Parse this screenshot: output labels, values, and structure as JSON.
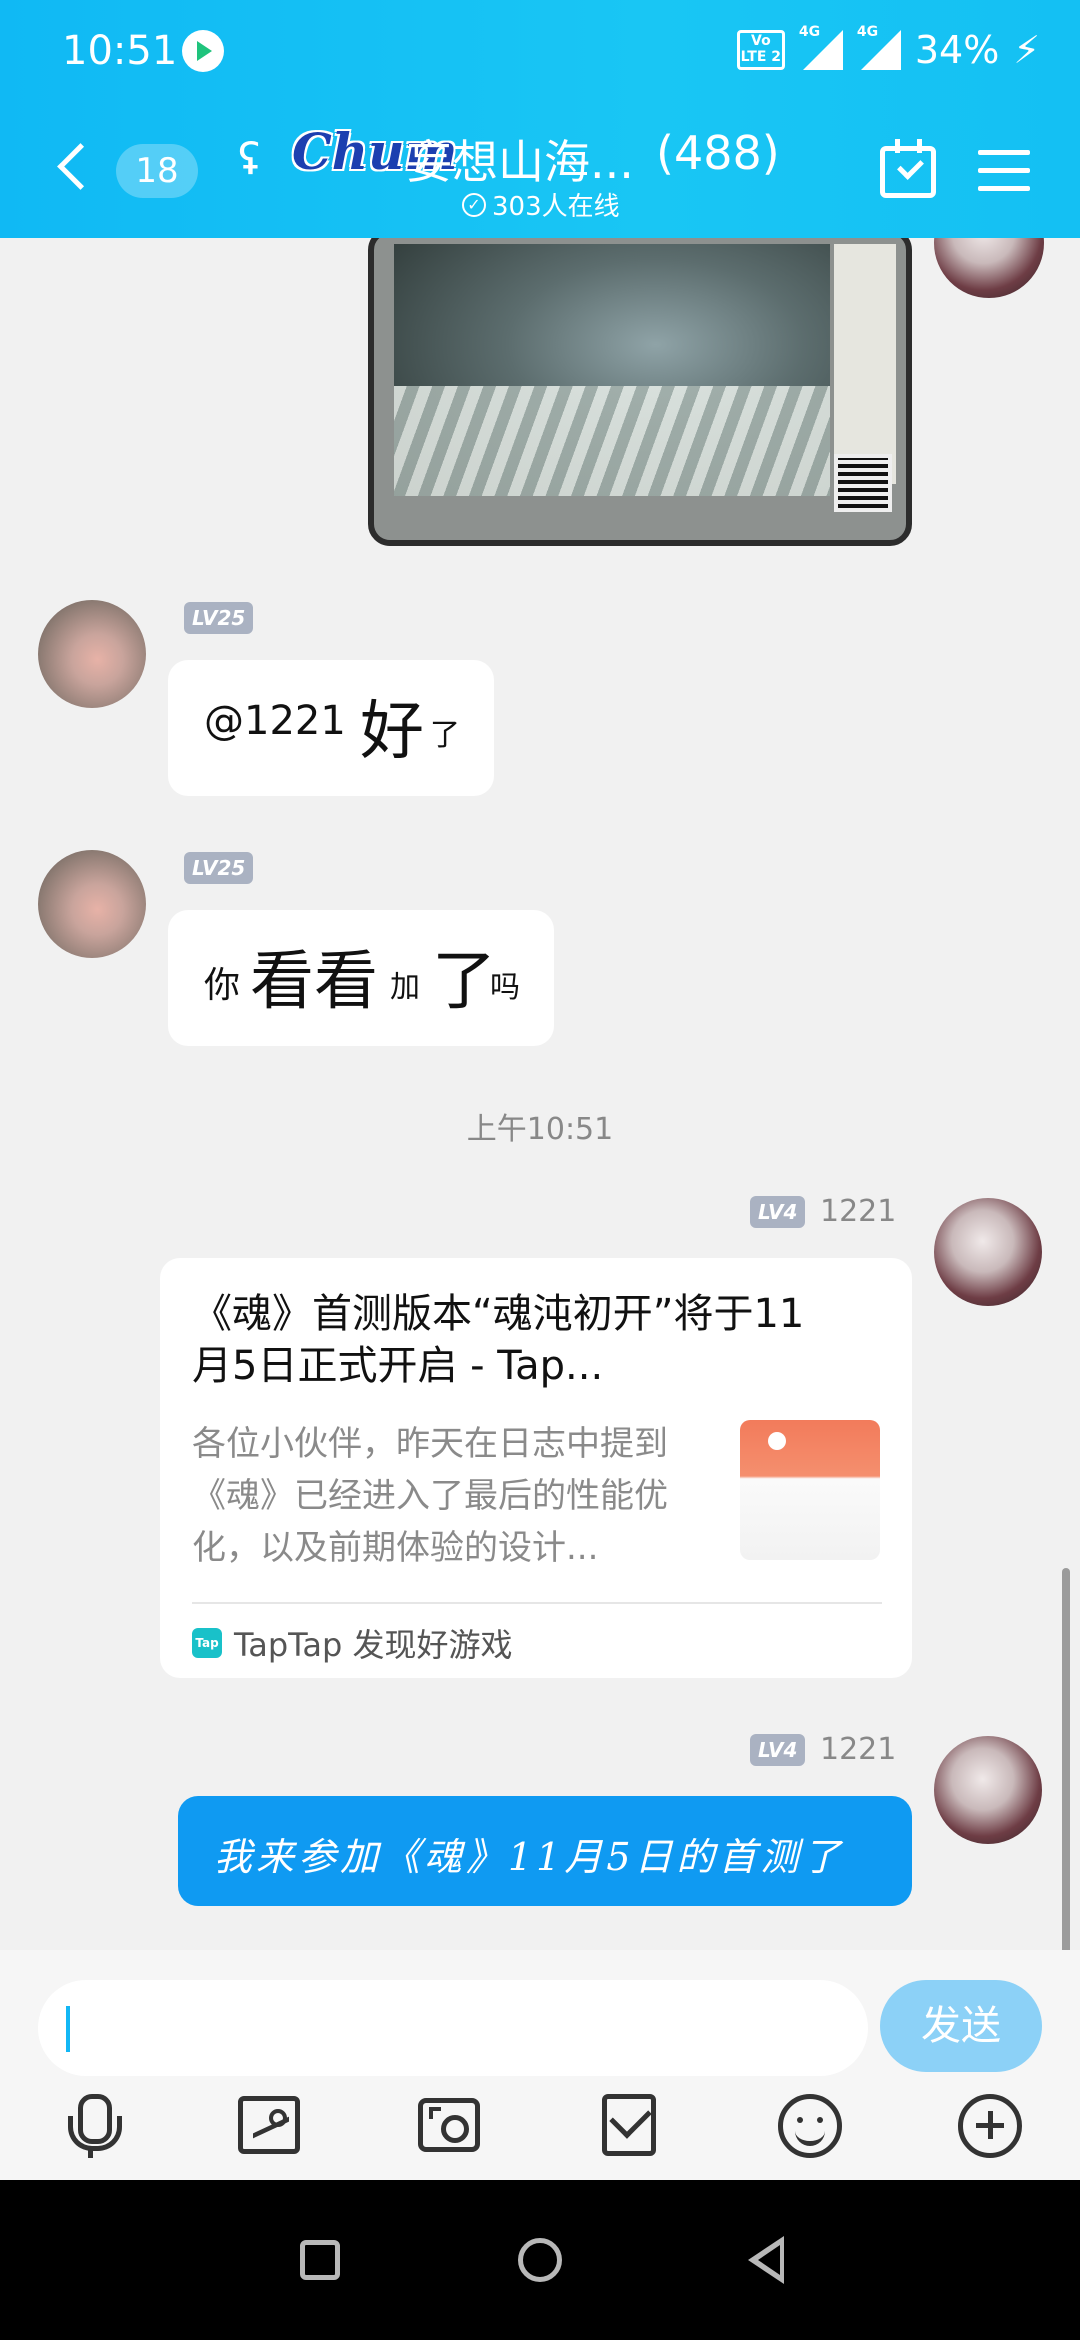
{
  "status_bar": {
    "time": "10:51",
    "volte_label": "Vo LTE 2",
    "network_1": "4G",
    "network_2": "4G",
    "battery": "34%",
    "icons": [
      "app-play-icon",
      "volte-icon",
      "signal-icon",
      "charging-bolt-icon"
    ]
  },
  "header": {
    "unread_count": "18",
    "logo_text": "Chum",
    "group_name": "妄想山海...",
    "member_count": "(488)",
    "online_text": "303人在线",
    "icons": [
      "back-icon",
      "ear-icon",
      "calendar-check-icon",
      "menu-icon"
    ]
  },
  "messages": [
    {
      "type": "image",
      "side": "right",
      "alt": "game screenshot with QR code"
    },
    {
      "type": "text",
      "side": "left",
      "level": "LV25",
      "segments": [
        "@1221 ",
        "好",
        "了"
      ]
    },
    {
      "type": "text",
      "side": "left",
      "level": "LV25",
      "segments": [
        "你",
        "看看",
        "加",
        "了",
        "吗"
      ]
    },
    {
      "type": "time",
      "text": "上午10:51"
    },
    {
      "type": "link",
      "side": "right",
      "level": "LV4",
      "sender": "1221",
      "title": "《魂》首测版本“魂沌初开”将于11月5日正式开启 - Tap...",
      "description": "各位小伙伴，昨天在日志中提到《魂》已经进入了最后的性能优化，以及前期体验的设计...",
      "source": "TapTap 发现好游戏",
      "source_icon_text": "Tap"
    },
    {
      "type": "text",
      "side": "right",
      "level": "LV4",
      "sender": "1221",
      "text": "我来参加《魂》11月5日的首测了"
    }
  ],
  "input": {
    "placeholder": "",
    "send_label": "发送"
  },
  "toolbar_icons": [
    "microphone-icon",
    "image-icon",
    "camera-icon",
    "red-packet-icon",
    "emoji-icon",
    "plus-icon"
  ],
  "colors": {
    "header_blue": "#14c0f3",
    "sent_bubble": "#0f9af2",
    "send_button": "#8cd1f7",
    "level_badge": "#aab2c2"
  }
}
